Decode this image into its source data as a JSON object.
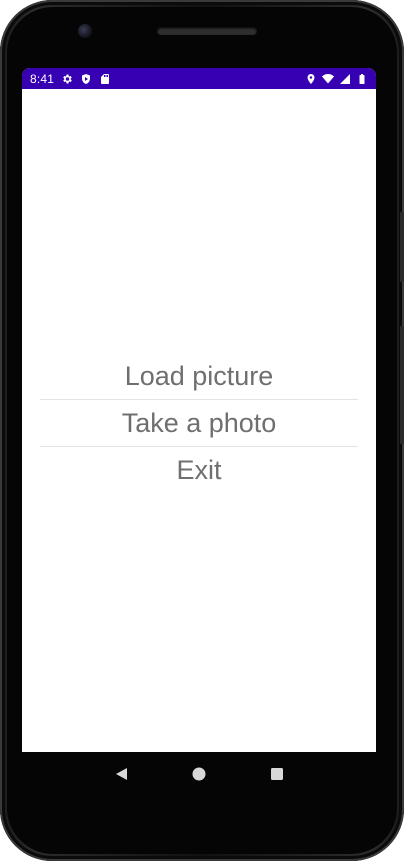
{
  "status_bar": {
    "time": "8:41",
    "background": "#3700b3",
    "left_icons": [
      "settings-icon",
      "shield-icon",
      "sd-card-icon"
    ],
    "right_icons": [
      "location-icon",
      "wifi-icon",
      "signal-icon",
      "battery-icon"
    ]
  },
  "menu": {
    "items": [
      {
        "label": "Load picture"
      },
      {
        "label": "Take a photo"
      },
      {
        "label": "Exit"
      }
    ],
    "text_color": "#6f6f6f"
  },
  "nav_bar": {
    "icons": [
      "back-icon",
      "home-icon",
      "recents-icon"
    ]
  }
}
